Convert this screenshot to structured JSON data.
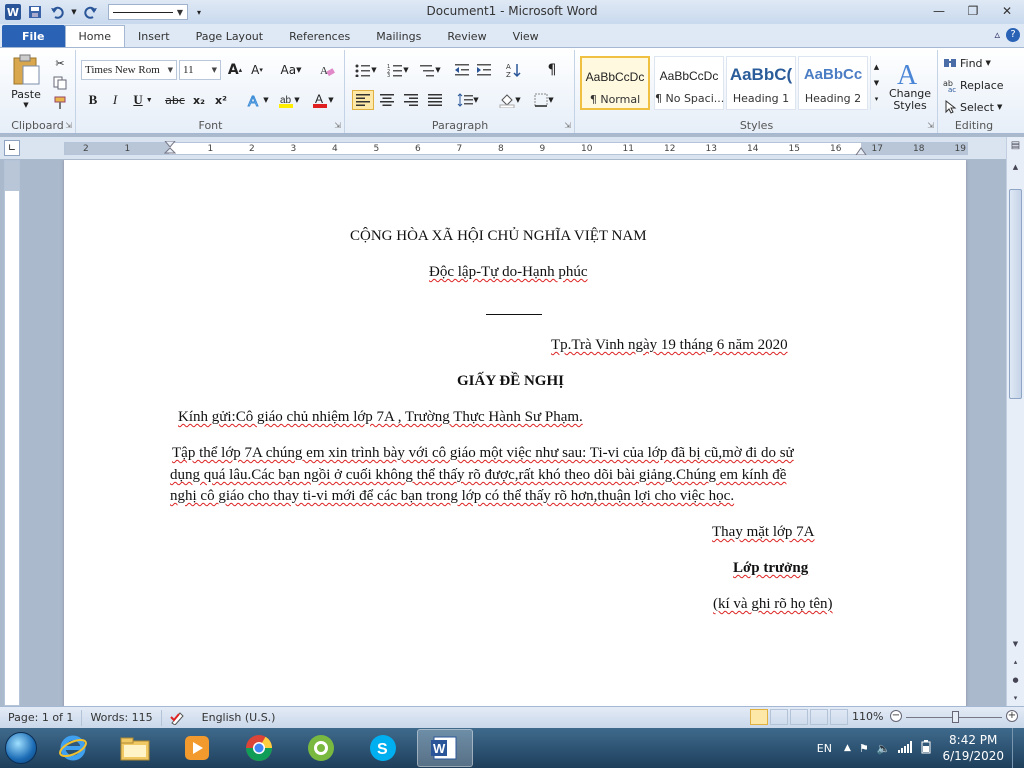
{
  "window": {
    "title": "Document1  -  Microsoft Word",
    "minimize": "—",
    "restore": "❐",
    "close": "✕"
  },
  "ribbon_tabs": {
    "file": "File",
    "home": "Home",
    "insert": "Insert",
    "page_layout": "Page Layout",
    "references": "References",
    "mailings": "Mailings",
    "review": "Review",
    "view": "View"
  },
  "clipboard": {
    "paste": "Paste",
    "label": "Clipboard"
  },
  "font": {
    "name": "Times New Rom",
    "size": "11",
    "label": "Font",
    "bold": "B",
    "italic": "I",
    "underline": "U",
    "strike": "abc",
    "subscript": "x₂",
    "superscript": "x²",
    "grow": "A",
    "shrink": "A",
    "case": "Aa",
    "color": "A"
  },
  "paragraph": {
    "label": "Paragraph"
  },
  "styles": {
    "label": "Styles",
    "items": [
      {
        "sample": "AaBbCcDc",
        "name": "¶ Normal"
      },
      {
        "sample": "AaBbCcDc",
        "name": "¶ No Spaci..."
      },
      {
        "sample": "AaBbC(",
        "name": "Heading 1"
      },
      {
        "sample": "AaBbCc",
        "name": "Heading 2"
      }
    ],
    "change_styles": "Change Styles"
  },
  "editing": {
    "label": "Editing",
    "find": "Find",
    "replace": "Replace",
    "select": "Select"
  },
  "ruler_numbers": [
    "2",
    "1",
    "1",
    "2",
    "3",
    "4",
    "5",
    "6",
    "7",
    "8",
    "9",
    "10",
    "11",
    "12",
    "13",
    "14",
    "15",
    "16",
    "17",
    "18",
    "19"
  ],
  "document": {
    "line1": "CỘNG HÒA XÃ HỘI CHỦ NGHĨA VIỆT NAM",
    "line2": "Độc lập-Tự  do-Hạnh phúc",
    "line3": "Tp.Trà  Vinh ngày 19 tháng  6 năm 2020",
    "title": "GIẤY ĐỀ NGHỊ",
    "recipient": "Kính  gửi:Cô giáo  chủ  nhiệm lớp  7A , Trường  Thực  Hành  Sư Phạm.",
    "body1": "Tập thể lớp 7A chúng  em  xin trình bày với cô giáo một việc như sau: Ti-vi  của lớp đã bị cũ,mờ đi  do sử",
    "body2": "dụng quá lâu.Các bạn ngồi ở cuối không thể thấy rõ được,rất khó theo dõi bài giảng.Chúng  em kính đề",
    "body3": "nghị  cô giáo cho thay ti-vi mới để các bạn trong lớp có thể thấy rõ hơn,thuận lợi cho việc học.",
    "sign1": "Thay  mặt lớp  7A",
    "sign2": "Lớp trưởng",
    "sign3": "(kí và ghi rõ họ tên)"
  },
  "status": {
    "page": "Page: 1 of 1",
    "words": "Words: 115",
    "language": "English (U.S.)",
    "zoom": "110%"
  },
  "taskbar": {
    "lang": "EN",
    "time": "8:42 PM",
    "date": "6/19/2020"
  }
}
